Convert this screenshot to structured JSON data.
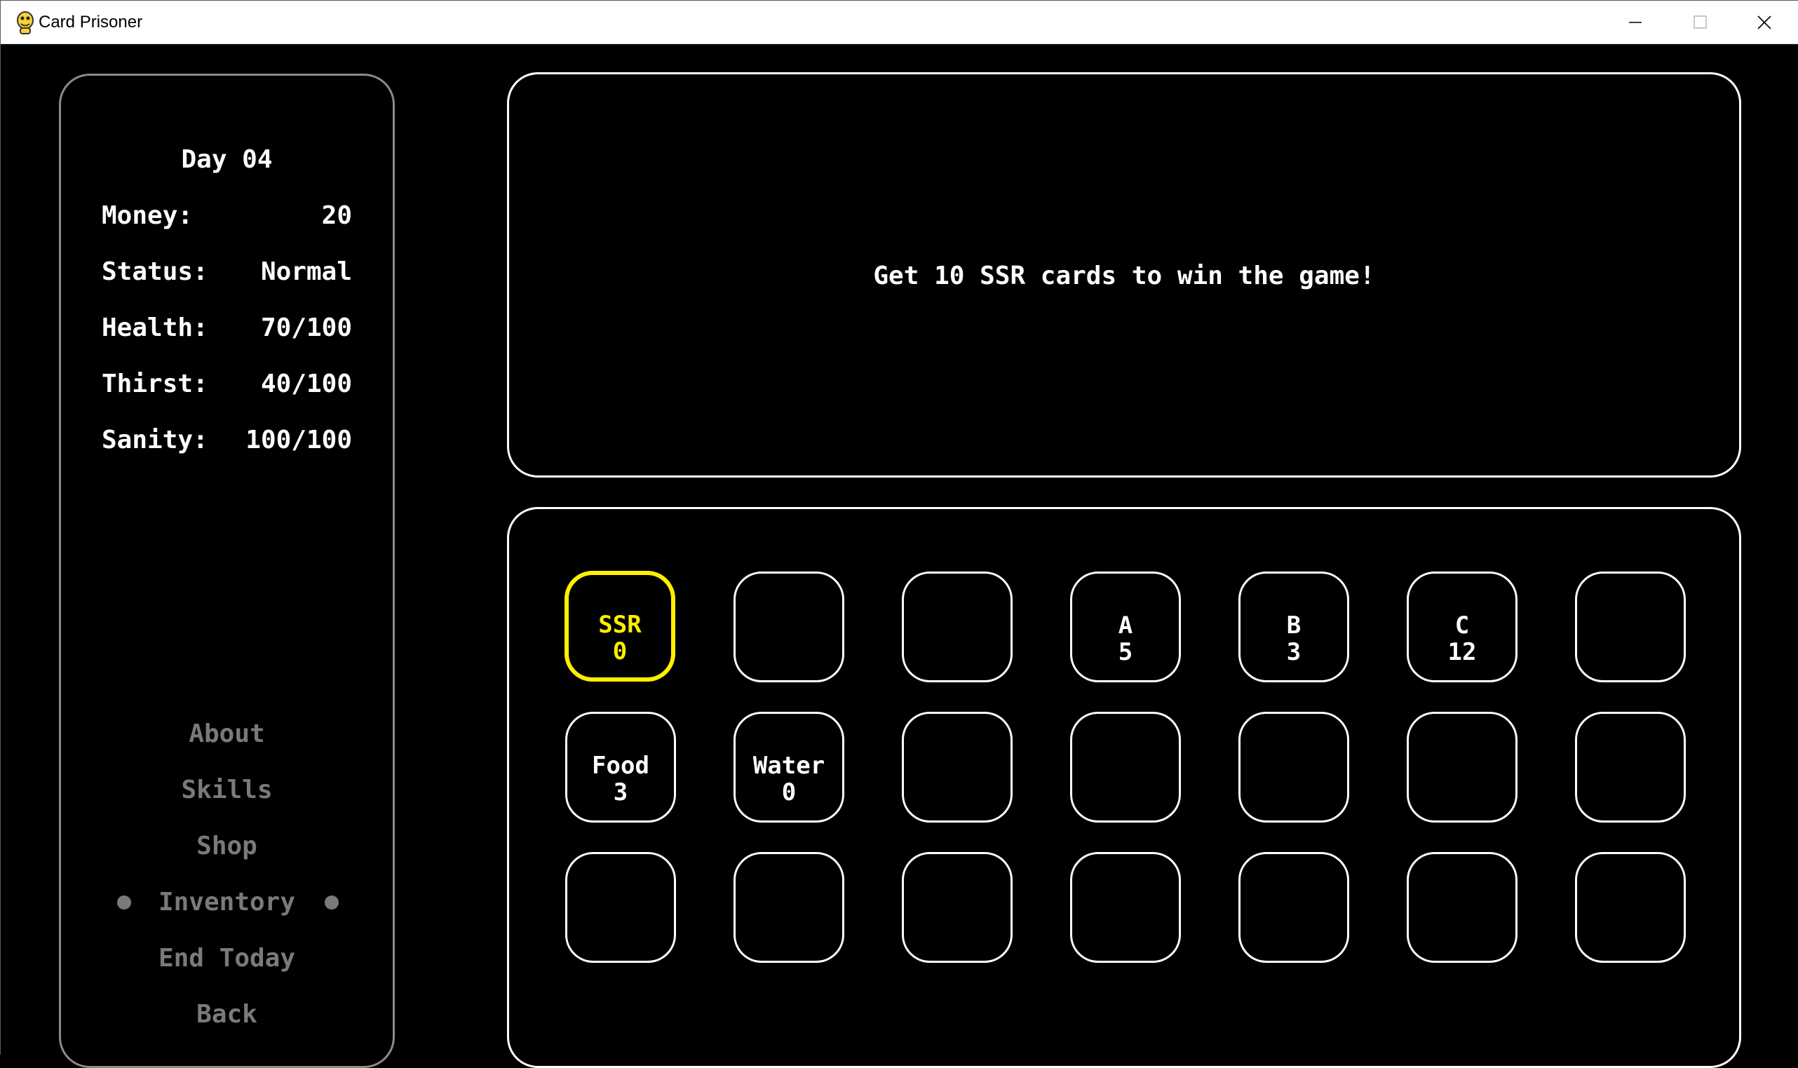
{
  "window": {
    "title": "Card Prisoner"
  },
  "stats": {
    "day": "Day 04",
    "money_label": "Money:",
    "money_value": "20",
    "status_label": "Status:",
    "status_value": "Normal",
    "health_label": "Health:",
    "health_value": "70/100",
    "thirst_label": "Thirst:",
    "thirst_value": "40/100",
    "sanity_label": "Sanity:",
    "sanity_value": "100/100"
  },
  "menu": {
    "about": "About",
    "skills": "Skills",
    "shop": "Shop",
    "inventory": "Inventory",
    "end_today": "End Today",
    "back": "Back",
    "selected": "Inventory"
  },
  "message": "Get 10 SSR cards to win the game!",
  "inventory": {
    "rows": [
      [
        {
          "name": "SSR",
          "count": "0",
          "selected": true
        },
        {
          "name": "",
          "count": ""
        },
        {
          "name": "",
          "count": ""
        },
        {
          "name": "A",
          "count": "5"
        },
        {
          "name": "B",
          "count": "3"
        },
        {
          "name": "C",
          "count": "12"
        },
        {
          "name": "",
          "count": ""
        }
      ],
      [
        {
          "name": "Food",
          "count": "3"
        },
        {
          "name": "Water",
          "count": "0"
        },
        {
          "name": "",
          "count": ""
        },
        {
          "name": "",
          "count": ""
        },
        {
          "name": "",
          "count": ""
        },
        {
          "name": "",
          "count": ""
        },
        {
          "name": "",
          "count": ""
        }
      ],
      [
        {
          "name": "",
          "count": ""
        },
        {
          "name": "",
          "count": ""
        },
        {
          "name": "",
          "count": ""
        },
        {
          "name": "",
          "count": ""
        },
        {
          "name": "",
          "count": ""
        },
        {
          "name": "",
          "count": ""
        },
        {
          "name": "",
          "count": ""
        }
      ]
    ]
  },
  "colors": {
    "background": "#000000",
    "text": "#ffffff",
    "menu_text": "#7a7a7a",
    "selected_slot": "#ffef00"
  }
}
